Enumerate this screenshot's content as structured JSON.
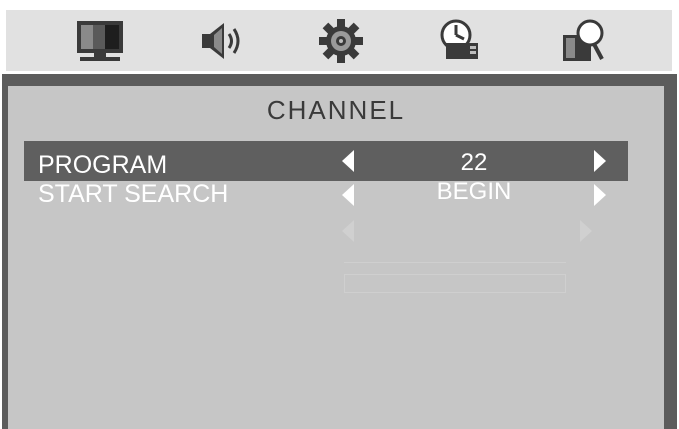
{
  "menu_icons": [
    {
      "name": "picture-icon"
    },
    {
      "name": "sound-icon"
    },
    {
      "name": "setup-gear-icon"
    },
    {
      "name": "timer-icon"
    },
    {
      "name": "channel-search-icon"
    }
  ],
  "panel": {
    "title": "CHANNEL",
    "rows": [
      {
        "label": "PROGRAM",
        "value": "22",
        "selected": true
      },
      {
        "label": "START SEARCH",
        "value": "BEGIN",
        "selected": false
      }
    ]
  },
  "colors": {
    "icon_bar_bg": "#e1e1e1",
    "panel_frame": "#5c5c5c",
    "panel_bg": "#c6c6c6",
    "selected_row": "#5f5f5f",
    "text": "#ffffff",
    "title_text": "#3a3a3a"
  }
}
